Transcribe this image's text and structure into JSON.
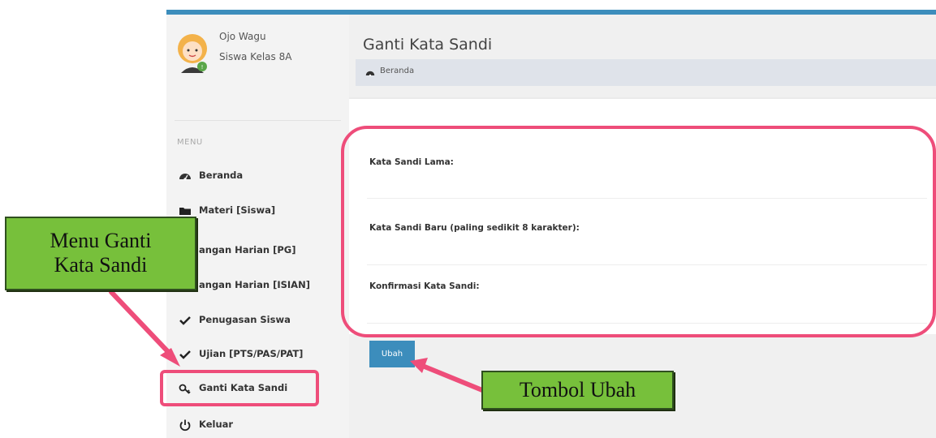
{
  "user": {
    "name": "Ojo Wagu",
    "class": "Siswa Kelas 8A"
  },
  "menu": {
    "header": "MENU",
    "items": [
      {
        "label": "Beranda",
        "icon": "dashboard-icon"
      },
      {
        "label": "Materi [Siswa]",
        "icon": "folder-icon"
      },
      {
        "label": "angan Harian [PG]",
        "icon": "edit-icon"
      },
      {
        "label": "angan Harian [ISIAN]",
        "icon": "edit-icon"
      },
      {
        "label": "Penugasan Siswa",
        "icon": "check-icon"
      },
      {
        "label": "Ujian [PTS/PAS/PAT]",
        "icon": "check-icon"
      },
      {
        "label": "Ganti Kata Sandi",
        "icon": "key-icon"
      },
      {
        "label": "Keluar",
        "icon": "power-icon"
      }
    ]
  },
  "page": {
    "title": "Ganti Kata Sandi",
    "breadcrumb": "Beranda"
  },
  "form": {
    "old_label": "Kata Sandi Lama:",
    "new_label": "Kata Sandi Baru (paling sedikit 8 karakter):",
    "confirm_label": "Konfirmasi Kata Sandi:",
    "submit_label": "Ubah"
  },
  "annotations": {
    "menu_callout_line1": "Menu Ganti",
    "menu_callout_line2": "Kata Sandi",
    "button_callout": "Tombol Ubah"
  },
  "colors": {
    "accent": "#3c8dbc",
    "highlight": "#ee4d7a",
    "callout": "#77c03b"
  }
}
